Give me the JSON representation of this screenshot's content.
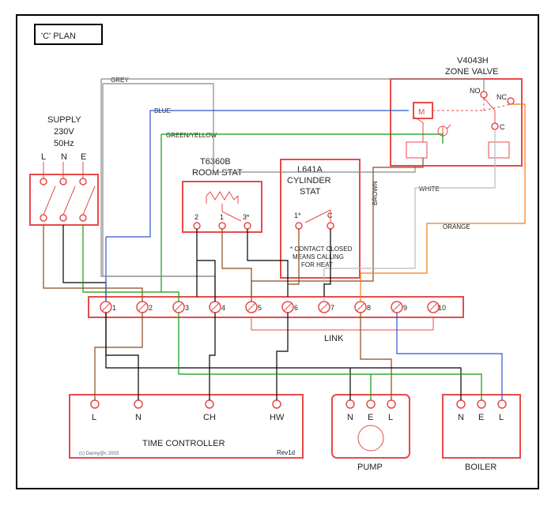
{
  "title": "'C' PLAN",
  "supply": {
    "label": "SUPPLY",
    "voltage": "230V",
    "freq": "50Hz",
    "terminals": [
      "L",
      "N",
      "E"
    ]
  },
  "roomstat": {
    "model": "T6360B",
    "name": "ROOM STAT",
    "terminals": [
      "2",
      "1",
      "3*"
    ]
  },
  "cylstat": {
    "model": "L641A",
    "name": "CYLINDER STAT",
    "terminals": [
      "1*",
      "C"
    ],
    "note1": "* CONTACT CLOSED",
    "note2": "MEANS CALLING",
    "note3": "FOR HEAT"
  },
  "zonevalve": {
    "model": "V4043H",
    "name": "ZONE VALVE",
    "labels": {
      "m": "M",
      "no": "NO",
      "nc": "NC",
      "c": "C"
    }
  },
  "strip": {
    "terminals": [
      "1",
      "2",
      "3",
      "4",
      "5",
      "6",
      "7",
      "8",
      "9",
      "10"
    ],
    "link": "LINK"
  },
  "timectrl": {
    "name": "TIME CONTROLLER",
    "terminals": [
      "L",
      "N",
      "CH",
      "HW"
    ]
  },
  "pump": {
    "name": "PUMP",
    "terminals": [
      "N",
      "E",
      "L"
    ]
  },
  "boiler": {
    "name": "BOILER",
    "terminals": [
      "N",
      "E",
      "L"
    ]
  },
  "wirecolors": {
    "grey": "GREY",
    "blue": "BLUE",
    "green": "GREEN/YELLOW",
    "brown": "BROWN",
    "white": "WHITE",
    "orange": "ORANGE"
  },
  "rev": "Rev1d",
  "copy": "(c) Danny@c 2003"
}
